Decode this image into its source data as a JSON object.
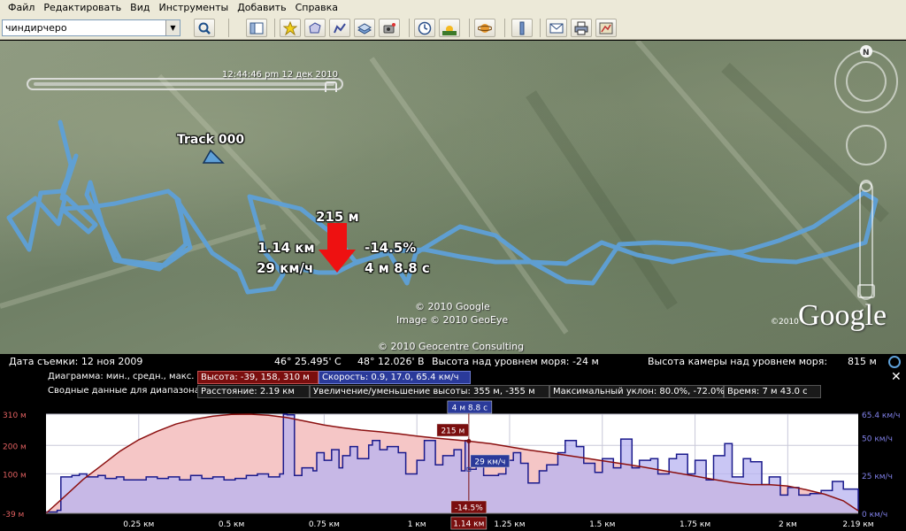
{
  "menu": [
    "Файл",
    "Редактировать",
    "Вид",
    "Инструменты",
    "Добавить",
    "Справка"
  ],
  "search": {
    "value": "чиндирчеро"
  },
  "toolbar_icons": [
    "sidebar-icon",
    "placemark-icon",
    "polygon-icon",
    "path-icon",
    "overlay-icon",
    "tour-icon",
    "clock-icon",
    "sun-icon",
    "planet-icon",
    "ruler-icon",
    "email-icon",
    "print-icon",
    "map-view-icon"
  ],
  "map": {
    "time_label": "12:44:46 pm 12 дек 2010",
    "track_name": "Track 000",
    "cursor": {
      "elevation": "215 м",
      "distance": "1.14 км",
      "speed": "29 км/ч",
      "slope": "-14.5%",
      "time": "4 м 8.8 с"
    },
    "copyrights": [
      "© 2010 Google",
      "Image © 2010 GeoEye",
      "© 2010 Geocentre Consulting"
    ],
    "google_year": "©2010",
    "google_logo": "Google",
    "compass_letter": "N",
    "track_color": "#5ea0d8"
  },
  "status": {
    "capture_date": "Дата съемки: 12 ноя 2009",
    "lat": "46° 25.495' С",
    "lon": "48° 12.026' В",
    "elev_sea": "Высота над уровнем моря:  -24 м",
    "camera_alt_label": "Высота камеры над уровнем моря:",
    "camera_alt_value": "815 м"
  },
  "panel": {
    "chart_label": "Диаграмма: мин., средн., макс.",
    "elev_stat": "Высота: -39, 158, 310 м",
    "speed_stat": "Скорость: 0.9, 17.0, 65.4 км/ч",
    "range_label": "Сводные данные для диапазона:",
    "distance": "Расстояние: 2.19 км",
    "gain_loss": "Увеличение/уменьшение высоты: 355 м, -355 м",
    "max_slope": "Максимальный уклон: 80.0%, -72.0%",
    "duration": "Время: 7 м 43.0 с",
    "close": "✕"
  },
  "chart_data": {
    "type": "area",
    "x_ticks": [
      "0.25 км",
      "0.5 км",
      "0.75 км",
      "1 км",
      "1.25 км",
      "1.5 км",
      "1.75 км",
      "2 км",
      "2.19 км"
    ],
    "x_tick_values": [
      0.25,
      0.5,
      0.75,
      1.0,
      1.25,
      1.5,
      1.75,
      2.0,
      2.19
    ],
    "y_left_ticks": [
      "310 м",
      "200 м",
      "100 м",
      "-39 м"
    ],
    "y_left_values": [
      310,
      200,
      100,
      -39
    ],
    "y_right_ticks": [
      "65.4 км/ч",
      "50 км/ч",
      "25 км/ч",
      "0 км/ч"
    ],
    "y_right_values": [
      65.4,
      50,
      25,
      0
    ],
    "xlim": [
      0,
      2.19
    ],
    "ylim_left": [
      -39,
      310
    ],
    "ylim_right": [
      0,
      65.4
    ],
    "cursor": {
      "x": 1.14,
      "elevation_label": "215 м",
      "speed_label": "29 км/ч",
      "slope_label": "-14.5%",
      "time_label": "4 м 8.8 с",
      "distance_label": "1.14 км"
    },
    "elevation": {
      "name": "Высота",
      "color": "#8b1010",
      "x": [
        0,
        0.05,
        0.1,
        0.15,
        0.2,
        0.25,
        0.3,
        0.35,
        0.4,
        0.45,
        0.5,
        0.55,
        0.6,
        0.65,
        0.7,
        0.75,
        0.8,
        0.85,
        0.9,
        0.95,
        1.0,
        1.05,
        1.1,
        1.14,
        1.2,
        1.25,
        1.3,
        1.35,
        1.4,
        1.45,
        1.5,
        1.55,
        1.6,
        1.65,
        1.7,
        1.75,
        1.8,
        1.85,
        1.9,
        1.95,
        2.0,
        2.05,
        2.1,
        2.15,
        2.19
      ],
      "values": [
        -39,
        20,
        80,
        130,
        180,
        220,
        250,
        275,
        292,
        303,
        309,
        310,
        306,
        298,
        285,
        272,
        262,
        254,
        248,
        241,
        233,
        226,
        220,
        215,
        206,
        195,
        184,
        175,
        166,
        156,
        146,
        136,
        126,
        115,
        103,
        92,
        80,
        69,
        62,
        62,
        57,
        44,
        28,
        5,
        -30
      ]
    },
    "speed": {
      "name": "Скорость",
      "color": "#1a1a8c",
      "x": [
        0,
        0.03,
        0.04,
        0.07,
        0.09,
        0.11,
        0.14,
        0.16,
        0.19,
        0.21,
        0.24,
        0.27,
        0.3,
        0.33,
        0.36,
        0.39,
        0.42,
        0.45,
        0.48,
        0.51,
        0.54,
        0.57,
        0.6,
        0.63,
        0.64,
        0.65,
        0.67,
        0.69,
        0.72,
        0.73,
        0.75,
        0.77,
        0.79,
        0.8,
        0.82,
        0.84,
        0.87,
        0.88,
        0.9,
        0.92,
        0.95,
        0.97,
        1.0,
        1.02,
        1.05,
        1.07,
        1.1,
        1.12,
        1.13,
        1.14,
        1.16,
        1.18,
        1.2,
        1.22,
        1.24,
        1.26,
        1.28,
        1.3,
        1.33,
        1.35,
        1.38,
        1.4,
        1.43,
        1.45,
        1.48,
        1.5,
        1.53,
        1.55,
        1.58,
        1.6,
        1.63,
        1.65,
        1.68,
        1.7,
        1.73,
        1.75,
        1.78,
        1.8,
        1.83,
        1.85,
        1.88,
        1.9,
        1.93,
        1.95,
        1.98,
        2.0,
        2.03,
        2.06,
        2.09,
        2.12,
        2.15,
        2.19
      ],
      "values": [
        0.9,
        2,
        24,
        25,
        26,
        24,
        25,
        23,
        24,
        22,
        22,
        24,
        23,
        24,
        22,
        25,
        23,
        24,
        22,
        23,
        25,
        26,
        24,
        26,
        65.4,
        65,
        25,
        30,
        28,
        40,
        35,
        42,
        30,
        38,
        44,
        36,
        45,
        48,
        42,
        44,
        40,
        26,
        35,
        48,
        32,
        38,
        42,
        28,
        48,
        29,
        35,
        25,
        25,
        26,
        35,
        40,
        33,
        20,
        28,
        32,
        40,
        48,
        44,
        33,
        27,
        36,
        30,
        49,
        30,
        35,
        36,
        26,
        36,
        39,
        26,
        35,
        22,
        38,
        46,
        24,
        36,
        34,
        19,
        24,
        12,
        17,
        12,
        13,
        15,
        21,
        16,
        2
      ]
    }
  }
}
